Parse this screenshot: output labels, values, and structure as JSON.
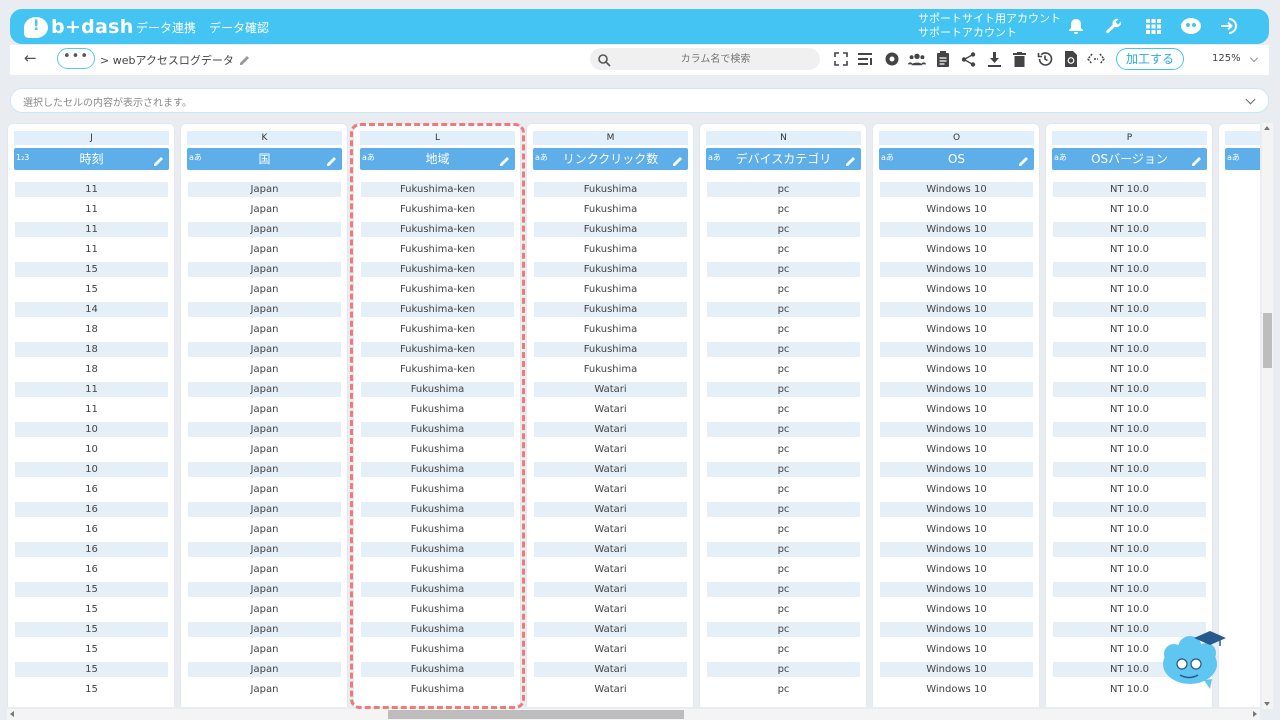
{
  "header": {
    "logo": "b+dash",
    "nav": [
      "データ連携",
      "データ確認"
    ],
    "account_line1": "サポートサイト用アカウント",
    "account_line2": "サポートアカウント"
  },
  "toolbar": {
    "more": "•••",
    "breadcrumb": "> webアクセスログデータ",
    "search_placeholder": "カラム名で検索",
    "process_button": "加工する",
    "zoom": "125%"
  },
  "cellbar": {
    "text": "選択したセルの内容が表示されます。"
  },
  "colors": {
    "accent": "#43c4f2",
    "header": "#5daee9",
    "highlight": "#ee7a7a"
  },
  "columns": [
    {
      "letter": "J",
      "name": "時刻",
      "type": "1₂3",
      "cells": [
        "11",
        "11",
        "11",
        "11",
        "15",
        "15",
        "14",
        "18",
        "18",
        "18",
        "11",
        "11",
        "10",
        "10",
        "10",
        "16",
        "16",
        "16",
        "16",
        "16",
        "15",
        "15",
        "15",
        "15",
        "15",
        "15"
      ]
    },
    {
      "letter": "K",
      "name": "国",
      "type": "aあ",
      "cells": [
        "Japan",
        "Japan",
        "Japan",
        "Japan",
        "Japan",
        "Japan",
        "Japan",
        "Japan",
        "Japan",
        "Japan",
        "Japan",
        "Japan",
        "Japan",
        "Japan",
        "Japan",
        "Japan",
        "Japan",
        "Japan",
        "Japan",
        "Japan",
        "Japan",
        "Japan",
        "Japan",
        "Japan",
        "Japan",
        "Japan"
      ]
    },
    {
      "letter": "L",
      "name": "地域",
      "type": "aあ",
      "cells": [
        "Fukushima-ken",
        "Fukushima-ken",
        "Fukushima-ken",
        "Fukushima-ken",
        "Fukushima-ken",
        "Fukushima-ken",
        "Fukushima-ken",
        "Fukushima-ken",
        "Fukushima-ken",
        "Fukushima-ken",
        "Fukushima",
        "Fukushima",
        "Fukushima",
        "Fukushima",
        "Fukushima",
        "Fukushima",
        "Fukushima",
        "Fukushima",
        "Fukushima",
        "Fukushima",
        "Fukushima",
        "Fukushima",
        "Fukushima",
        "Fukushima",
        "Fukushima",
        "Fukushima"
      ]
    },
    {
      "letter": "M",
      "name": "リンククリック数",
      "type": "aあ",
      "cells": [
        "Fukushima",
        "Fukushima",
        "Fukushima",
        "Fukushima",
        "Fukushima",
        "Fukushima",
        "Fukushima",
        "Fukushima",
        "Fukushima",
        "Fukushima",
        "Watari",
        "Watari",
        "Watari",
        "Watari",
        "Watari",
        "Watari",
        "Watari",
        "Watari",
        "Watari",
        "Watari",
        "Watari",
        "Watari",
        "Watari",
        "Watari",
        "Watari",
        "Watari"
      ]
    },
    {
      "letter": "N",
      "name": "デバイスカテゴリ",
      "type": "aあ",
      "cells": [
        "pc",
        "pc",
        "pc",
        "pc",
        "pc",
        "pc",
        "pc",
        "pc",
        "pc",
        "pc",
        "pc",
        "pc",
        "pc",
        "pc",
        "pc",
        "pc",
        "pc",
        "pc",
        "pc",
        "pc",
        "pc",
        "pc",
        "pc",
        "pc",
        "pc",
        "pc"
      ]
    },
    {
      "letter": "O",
      "name": "OS",
      "type": "aあ",
      "cells": [
        "Windows 10",
        "Windows 10",
        "Windows 10",
        "Windows 10",
        "Windows 10",
        "Windows 10",
        "Windows 10",
        "Windows 10",
        "Windows 10",
        "Windows 10",
        "Windows 10",
        "Windows 10",
        "Windows 10",
        "Windows 10",
        "Windows 10",
        "Windows 10",
        "Windows 10",
        "Windows 10",
        "Windows 10",
        "Windows 10",
        "Windows 10",
        "Windows 10",
        "Windows 10",
        "Windows 10",
        "Windows 10",
        "Windows 10"
      ]
    },
    {
      "letter": "P",
      "name": "OSバージョン",
      "type": "aあ",
      "cells": [
        "NT 10.0",
        "NT 10.0",
        "NT 10.0",
        "NT 10.0",
        "NT 10.0",
        "NT 10.0",
        "NT 10.0",
        "NT 10.0",
        "NT 10.0",
        "NT 10.0",
        "NT 10.0",
        "NT 10.0",
        "NT 10.0",
        "NT 10.0",
        "NT 10.0",
        "NT 10.0",
        "NT 10.0",
        "NT 10.0",
        "NT 10.0",
        "NT 10.0",
        "NT 10.0",
        "NT 10.0",
        "NT 10.0",
        "NT 10.0",
        "NT 10.0",
        "NT 10.0"
      ]
    },
    {
      "letter": "",
      "name": "",
      "type": "aあ",
      "cells": []
    }
  ]
}
